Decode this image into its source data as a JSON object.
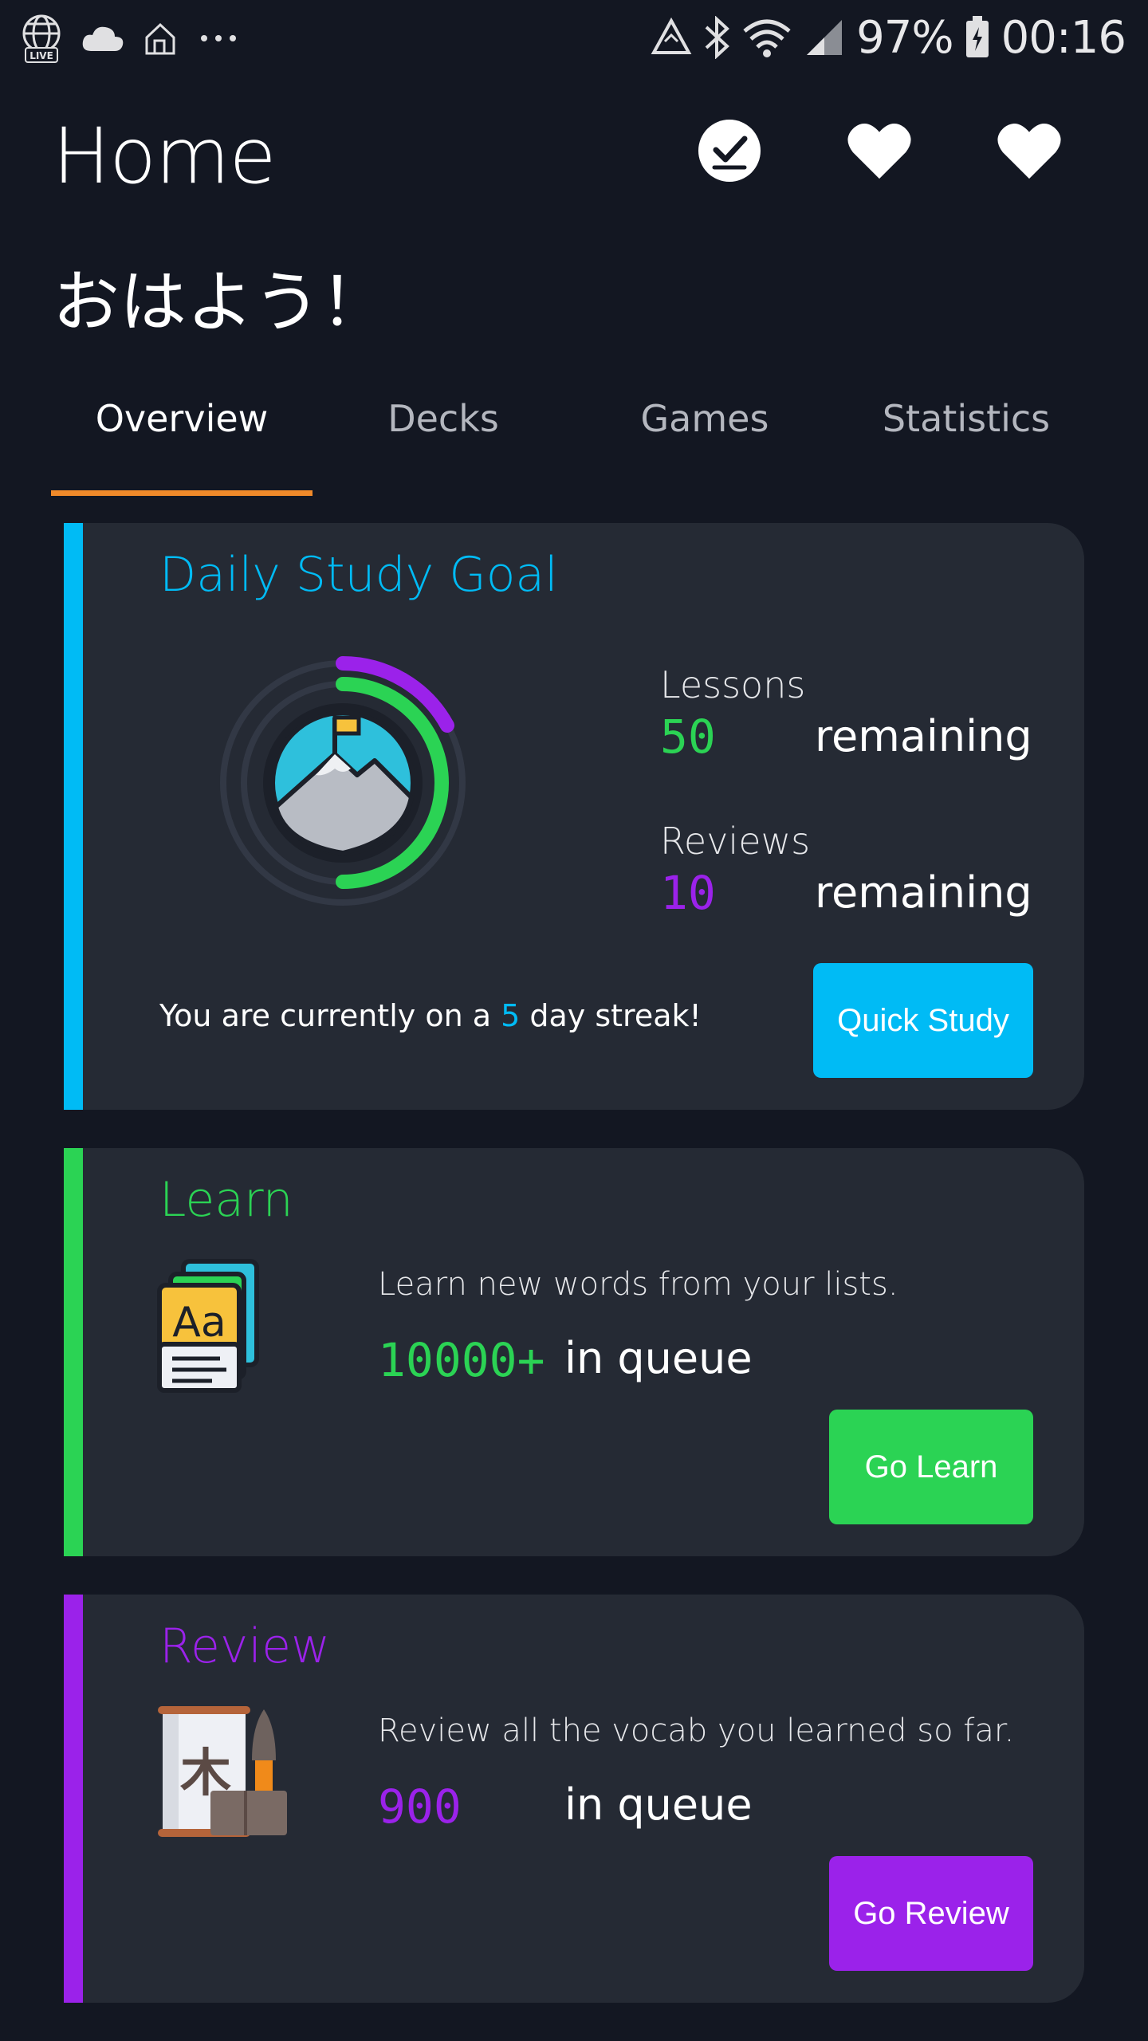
{
  "status_bar": {
    "left_icons": [
      "globe-live-icon",
      "cloud-icon",
      "home-icon",
      "more-dots-icon"
    ],
    "right_icons": [
      "recycle-icon",
      "bluetooth-icon",
      "wifi-icon",
      "signal-icon",
      "battery-icon"
    ],
    "live_badge": "LIVE",
    "battery_percent": "97%",
    "time": "00:16"
  },
  "header": {
    "title": "Home",
    "actions": [
      "check-circle-icon",
      "heart-icon",
      "heart-icon"
    ]
  },
  "greeting": "おはよう！",
  "tabs": [
    {
      "label": "Overview",
      "active": true
    },
    {
      "label": "Decks",
      "active": false
    },
    {
      "label": "Games",
      "active": false
    },
    {
      "label": "Statistics",
      "active": false
    }
  ],
  "goal_card": {
    "title": "Daily Study Goal",
    "accent_color": "#00bbf5",
    "lessons_label": "Lessons",
    "lessons_count": "50",
    "lessons_suffix": "remaining",
    "reviews_label": "Reviews",
    "reviews_count": "10",
    "reviews_suffix": "remaining",
    "streak_prefix": "You are currently on a ",
    "streak_days": "5",
    "streak_suffix": " day streak!",
    "button_label": "Quick Study",
    "ring_icon": "mountain-flag-icon"
  },
  "learn_card": {
    "title": "Learn",
    "accent_color": "#2bd354",
    "icon": "flashcards-aa-icon",
    "description": "Learn new words from your lists.",
    "queue_count": "10000+",
    "queue_suffix": "in queue",
    "button_label": "Go Learn"
  },
  "review_card": {
    "title": "Review",
    "accent_color": "#9b22ea",
    "icon": "kanji-scroll-brush-icon",
    "description": "Review all the vocab you learned so far.",
    "queue_count": "900",
    "queue_suffix": "in queue",
    "button_label": "Go Review"
  },
  "colors": {
    "background": "#131722",
    "card": "#252a34",
    "tab_indicator": "#f08a2a",
    "blue": "#00bbf5",
    "green": "#2bd354",
    "purple": "#9b22ea"
  }
}
